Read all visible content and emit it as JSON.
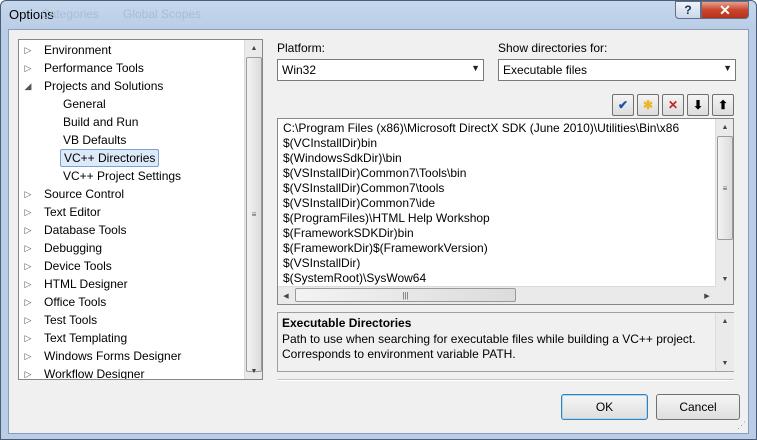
{
  "window": {
    "title": "Options",
    "help_glyph": "?",
    "close_glyph": "✕",
    "background_ghost_text": [
      "Categories",
      "Global Scopes"
    ]
  },
  "tree": {
    "items": [
      {
        "label": "Environment",
        "level": 0,
        "arrow": "collapsed"
      },
      {
        "label": "Performance Tools",
        "level": 0,
        "arrow": "collapsed"
      },
      {
        "label": "Projects and Solutions",
        "level": 0,
        "arrow": "expanded"
      },
      {
        "label": "General",
        "level": 1,
        "arrow": "none"
      },
      {
        "label": "Build and Run",
        "level": 1,
        "arrow": "none"
      },
      {
        "label": "VB Defaults",
        "level": 1,
        "arrow": "none"
      },
      {
        "label": "VC++ Directories",
        "level": 1,
        "arrow": "none",
        "selected": true
      },
      {
        "label": "VC++ Project Settings",
        "level": 1,
        "arrow": "none"
      },
      {
        "label": "Source Control",
        "level": 0,
        "arrow": "collapsed"
      },
      {
        "label": "Text Editor",
        "level": 0,
        "arrow": "collapsed"
      },
      {
        "label": "Database Tools",
        "level": 0,
        "arrow": "collapsed"
      },
      {
        "label": "Debugging",
        "level": 0,
        "arrow": "collapsed"
      },
      {
        "label": "Device Tools",
        "level": 0,
        "arrow": "collapsed"
      },
      {
        "label": "HTML Designer",
        "level": 0,
        "arrow": "collapsed"
      },
      {
        "label": "Office Tools",
        "level": 0,
        "arrow": "collapsed"
      },
      {
        "label": "Test Tools",
        "level": 0,
        "arrow": "collapsed"
      },
      {
        "label": "Text Templating",
        "level": 0,
        "arrow": "collapsed"
      },
      {
        "label": "Windows Forms Designer",
        "level": 0,
        "arrow": "collapsed"
      },
      {
        "label": "Workflow Designer",
        "level": 0,
        "arrow": "collapsed"
      }
    ]
  },
  "platform": {
    "label": "Platform:",
    "value": "Win32"
  },
  "show_dirs": {
    "label": "Show directories for:",
    "value": "Executable files"
  },
  "toolbar": {
    "check_glyph": "✔",
    "new_folder_glyph": "✱",
    "delete_glyph": "✕",
    "down_glyph": "⬇",
    "up_glyph": "⬆"
  },
  "directories": [
    "C:\\Program Files (x86)\\Microsoft DirectX SDK (June 2010)\\Utilities\\Bin\\x86",
    "$(VCInstallDir)bin",
    "$(WindowsSdkDir)\\bin",
    "$(VSInstallDir)Common7\\Tools\\bin",
    "$(VSInstallDir)Common7\\tools",
    "$(VSInstallDir)Common7\\ide",
    "$(ProgramFiles)\\HTML Help Workshop",
    "$(FrameworkSDKDir)bin",
    "$(FrameworkDir)$(FrameworkVersion)",
    "$(VSInstallDir)",
    "$(SystemRoot)\\SysWow64"
  ],
  "description": {
    "title": "Executable Directories",
    "text": "Path to use when searching for executable files while building a VC++ project. Corresponds to environment variable PATH."
  },
  "buttons": {
    "ok": "OK",
    "cancel": "Cancel"
  },
  "colors": {
    "close_button": "#c9452c",
    "selection_fill": "#dbe9f8",
    "check_icon": "#1a4fa8",
    "delete_icon": "#c62020",
    "folder_icon": "#e8b72a"
  }
}
